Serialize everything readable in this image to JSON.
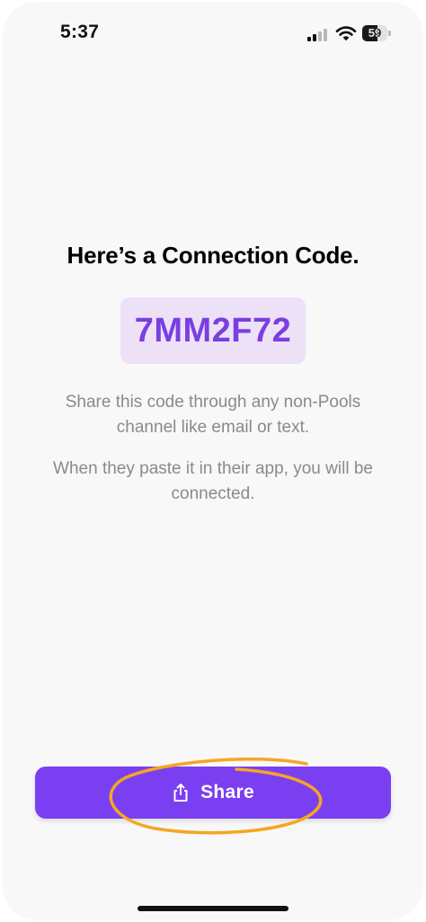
{
  "status_bar": {
    "time": "5:37",
    "battery_percent": 59,
    "battery_label": "59",
    "signal_bars_filled": 2,
    "signal_bars_total": 4
  },
  "screen": {
    "title": "Here’s a Connection Code.",
    "connection_code": "7MM2F72",
    "description_line_1": "Share this code through any non-Pools channel like email or text.",
    "description_line_2": "When they paste it in their app, you will be connected.",
    "share_button_label": "Share",
    "share_icon": "share-icon"
  },
  "colors": {
    "accent": "#7b3ff2",
    "code_text": "#7a3fe0",
    "code_background": "#ece1f7",
    "annotation": "#f5a623",
    "background": "#f8f8f8"
  }
}
